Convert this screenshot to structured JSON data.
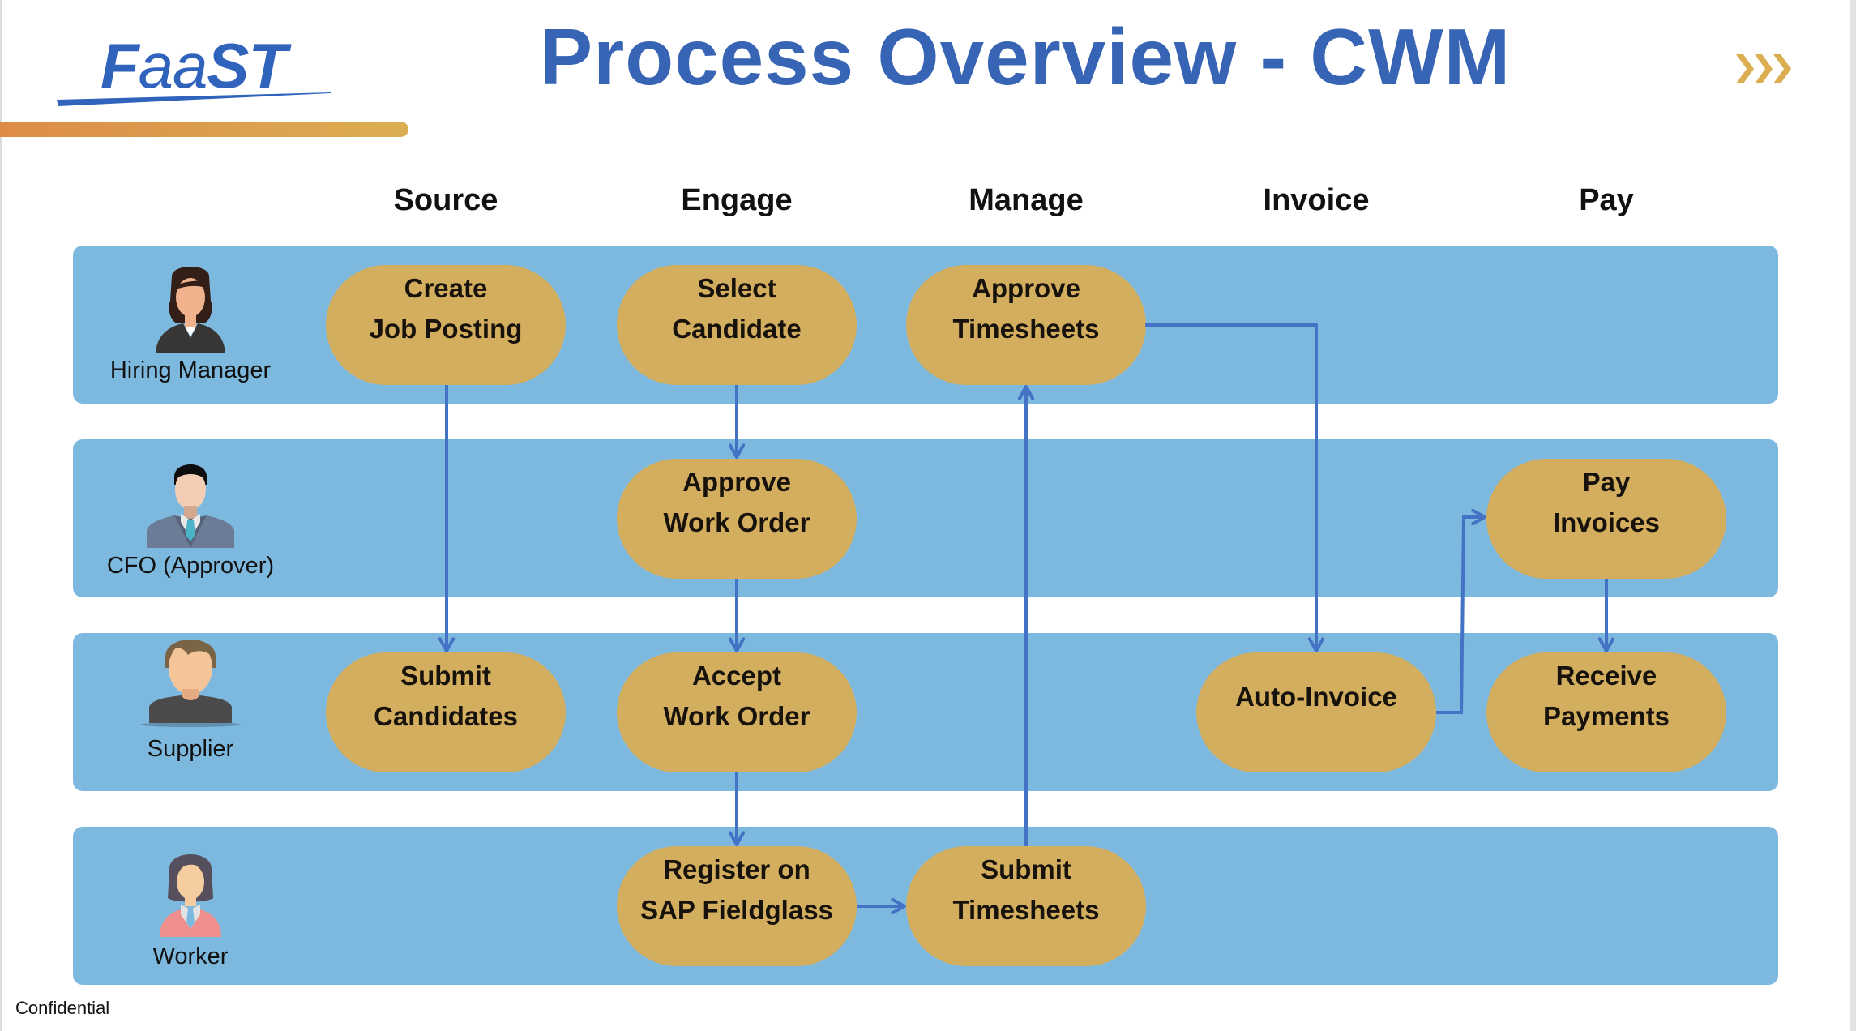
{
  "logo": {
    "text_bold_left": "F",
    "text_regular": "aa",
    "text_bold_right": "ST",
    "brand_color": "#2F63BC"
  },
  "title": "Process Overview - CWM",
  "accent_color": "#DBAE52",
  "next_icon": "triple-chevron-right-icon",
  "columns": [
    "Source",
    "Engage",
    "Manage",
    "Invoice",
    "Pay"
  ],
  "lanes": [
    {
      "role": "Hiring Manager",
      "icon": "hiring-manager-avatar"
    },
    {
      "role": "CFO (Approver)",
      "icon": "cfo-avatar"
    },
    {
      "role": "Supplier",
      "icon": "supplier-avatar"
    },
    {
      "role": "Worker",
      "icon": "worker-avatar"
    }
  ],
  "nodes": {
    "create_job_posting": {
      "lines": [
        "Create",
        "Job Posting"
      ],
      "lane": "Hiring Manager",
      "column": "Source"
    },
    "select_candidate": {
      "lines": [
        "Select",
        "Candidate"
      ],
      "lane": "Hiring Manager",
      "column": "Engage"
    },
    "approve_timesheets": {
      "lines": [
        "Approve",
        "Timesheets"
      ],
      "lane": "Hiring Manager",
      "column": "Manage"
    },
    "approve_work_order": {
      "lines": [
        "Approve",
        "Work Order"
      ],
      "lane": "CFO (Approver)",
      "column": "Engage"
    },
    "pay_invoices": {
      "lines": [
        "Pay",
        "Invoices"
      ],
      "lane": "CFO (Approver)",
      "column": "Pay"
    },
    "submit_candidates": {
      "lines": [
        "Submit",
        "Candidates"
      ],
      "lane": "Supplier",
      "column": "Source"
    },
    "accept_work_order": {
      "lines": [
        "Accept",
        "Work Order"
      ],
      "lane": "Supplier",
      "column": "Engage"
    },
    "auto_invoice": {
      "lines": [
        "Auto-Invoice"
      ],
      "lane": "Supplier",
      "column": "Invoice"
    },
    "receive_payments": {
      "lines": [
        "Receive",
        "Payments"
      ],
      "lane": "Supplier",
      "column": "Pay"
    },
    "register_sap_fieldglass": {
      "lines": [
        "Register on",
        "SAP Fieldglass"
      ],
      "lane": "Worker",
      "column": "Engage"
    },
    "submit_timesheets": {
      "lines": [
        "Submit",
        "Timesheets"
      ],
      "lane": "Worker",
      "column": "Manage"
    }
  },
  "edges": [
    {
      "from": "create_job_posting",
      "to": "submit_candidates"
    },
    {
      "from": "select_candidate",
      "to": "approve_work_order"
    },
    {
      "from": "approve_work_order",
      "to": "accept_work_order"
    },
    {
      "from": "accept_work_order",
      "to": "register_sap_fieldglass"
    },
    {
      "from": "register_sap_fieldglass",
      "to": "submit_timesheets"
    },
    {
      "from": "submit_timesheets",
      "to": "approve_timesheets"
    },
    {
      "from": "approve_timesheets",
      "to": "auto_invoice"
    },
    {
      "from": "auto_invoice",
      "to": "pay_invoices"
    },
    {
      "from": "pay_invoices",
      "to": "receive_payments"
    }
  ],
  "colors": {
    "lane": "#7DB9DF",
    "node": "#D3AE5F",
    "arrow": "#4472C4",
    "title": "#3764B4"
  },
  "footer": "Confidential"
}
